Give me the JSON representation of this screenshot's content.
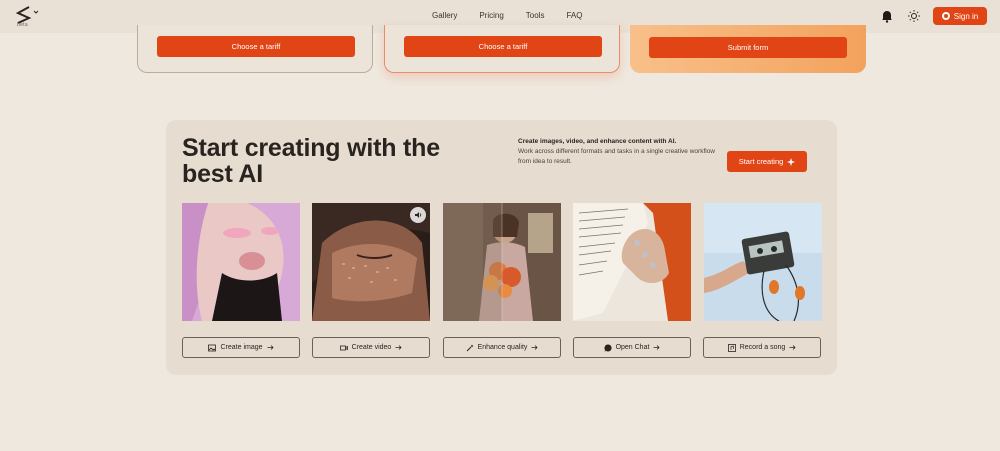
{
  "header": {
    "logo_badge": "beta",
    "nav": [
      "Gallery",
      "Pricing",
      "Tools",
      "FAQ"
    ],
    "signin_label": "Sign in"
  },
  "tariffs": [
    {
      "button": "Choose a tariff"
    },
    {
      "button": "Choose a tariff"
    },
    {
      "button": "Submit form"
    }
  ],
  "hero": {
    "title": "Start creating with the best AI",
    "description_bold": "Create images, video, and enhance content with AI.",
    "description": "Work across different formats and tasks in a single creative workflow from idea to result.",
    "start_label": "Start creating"
  },
  "actions": [
    {
      "label": "Create image",
      "icon": "image-icon"
    },
    {
      "label": "Create video",
      "icon": "video-icon"
    },
    {
      "label": "Enhance quality",
      "icon": "magic-wand-icon"
    },
    {
      "label": "Open Chat",
      "icon": "chat-icon"
    },
    {
      "label": "Record a song",
      "icon": "music-icon"
    }
  ],
  "colors": {
    "accent": "#e24515",
    "background": "#efe8de",
    "panel": "#e6ddd0"
  }
}
